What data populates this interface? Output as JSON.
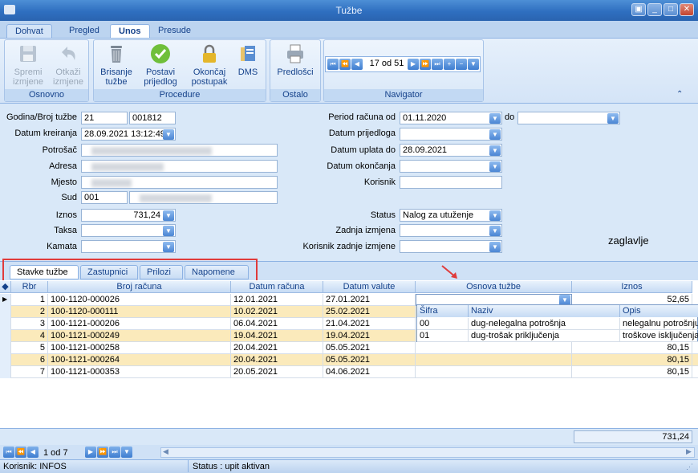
{
  "window": {
    "title": "Tužbe"
  },
  "ribbon_tabs": [
    {
      "label": "Dohvat"
    },
    {
      "label": "Pregled"
    },
    {
      "label": "Unos"
    },
    {
      "label": "Presude"
    }
  ],
  "ribbon": {
    "osnovno": {
      "label": "Osnovno",
      "spremi": "Spremi izmjene",
      "otkazi": "Otkaži izmjene"
    },
    "procedure": {
      "label": "Procedure",
      "brisanje": "Brisanje tužbe",
      "postavi": "Postavi prijedlog",
      "okoncaj": "Okončaj postupak",
      "dms": "DMS"
    },
    "ostalo": {
      "label": "Ostalo",
      "predlosci": "Predlošci"
    },
    "navigator": {
      "label": "Navigator",
      "position": "17 od 51"
    }
  },
  "form": {
    "godina_label": "Godina/Broj tužbe",
    "godina_value": "21",
    "broj_value": "001812",
    "datum_kreiranja_label": "Datum kreiranja",
    "datum_kreiranja_value": "28.09.2021 13:12:49",
    "potrosac_label": "Potrošač",
    "adresa_label": "Adresa",
    "mjesto_label": "Mjesto",
    "sud_label": "Sud",
    "sud_value": "001",
    "iznos_label": "Iznos",
    "iznos_value": "731,24",
    "taksa_label": "Taksa",
    "kamata_label": "Kamata",
    "period_label": "Period računa od",
    "period_od_value": "01.11.2020",
    "do_label": "do",
    "datum_prijedloga_label": "Datum prijedloga",
    "datum_uplata_label": "Datum uplata do",
    "datum_uplata_value": "28.09.2021",
    "datum_okoncanja_label": "Datum okončanja",
    "korisnik_label": "Korisnik",
    "status_label": "Status",
    "status_value": "Nalog za utuženje",
    "zadnja_izmjena_label": "Zadnja izmjena",
    "korisnik_zadnje_label": "Korisnik zadnje izmjene",
    "annotation": "zaglavlje"
  },
  "inner_tabs": [
    {
      "label": "Stavke tužbe"
    },
    {
      "label": "Zastupnici"
    },
    {
      "label": "Prilozi"
    },
    {
      "label": "Napomene"
    }
  ],
  "grid": {
    "columns": [
      "Rbr",
      "Broj računa",
      "Datum računa",
      "Datum valute",
      "Osnova tužbe",
      "Iznos"
    ],
    "rows": [
      {
        "rbr": "1",
        "broj": "100-1120-000026",
        "datum": "12.01.2021",
        "valuta": "27.01.2021",
        "osnova": "",
        "iznos": "52,65"
      },
      {
        "rbr": "2",
        "broj": "100-1120-000111",
        "datum": "10.02.2021",
        "valuta": "25.02.2021",
        "osnova": "",
        "iznos": ""
      },
      {
        "rbr": "3",
        "broj": "100-1121-000206",
        "datum": "06.04.2021",
        "valuta": "21.04.2021",
        "osnova": "",
        "iznos": ""
      },
      {
        "rbr": "4",
        "broj": "100-1121-000249",
        "datum": "19.04.2021",
        "valuta": "19.04.2021",
        "osnova": "",
        "iznos": ""
      },
      {
        "rbr": "5",
        "broj": "100-1121-000258",
        "datum": "20.04.2021",
        "valuta": "05.05.2021",
        "osnova": "",
        "iznos": "80,15"
      },
      {
        "rbr": "6",
        "broj": "100-1121-000264",
        "datum": "20.04.2021",
        "valuta": "05.05.2021",
        "osnova": "",
        "iznos": "80,15"
      },
      {
        "rbr": "7",
        "broj": "100-1121-000353",
        "datum": "20.05.2021",
        "valuta": "04.06.2021",
        "osnova": "",
        "iznos": "80,15"
      }
    ],
    "total": "731,24"
  },
  "popup": {
    "columns": [
      "Šifra",
      "Naziv",
      "Opis"
    ],
    "rows": [
      {
        "sifra": "00",
        "naziv": "dug-nelegalna potrošnja",
        "opis": "nelegalnu potrošnju"
      },
      {
        "sifra": "01",
        "naziv": "dug-trošak priključenja",
        "opis": "troškove isključenja"
      }
    ]
  },
  "pager": {
    "position": "1 od 7"
  },
  "status": {
    "user": "Korisnik: INFOS",
    "status": "Status : upit aktivan"
  }
}
